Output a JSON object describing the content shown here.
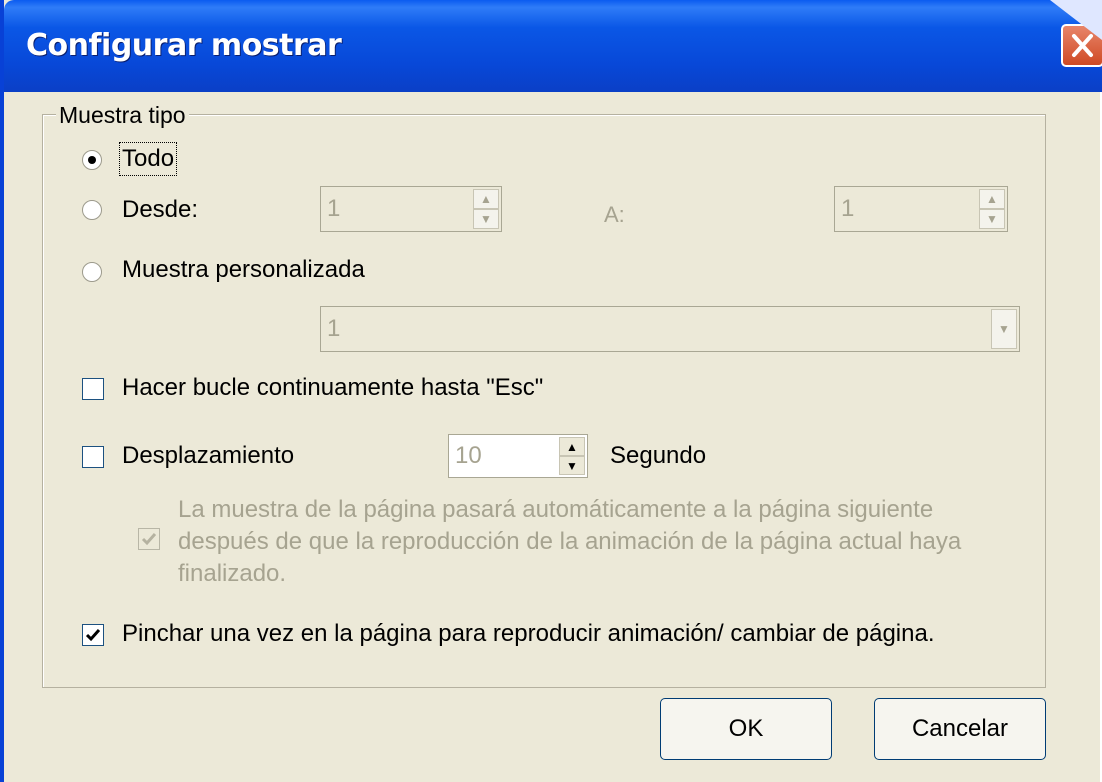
{
  "window": {
    "title": "Configurar mostrar"
  },
  "group": {
    "legend": "Muestra tipo"
  },
  "options": {
    "all": "Todo",
    "from": "Desde:",
    "to": "A:",
    "custom": "Muestra personalizada"
  },
  "fields": {
    "from_value": "1",
    "to_value": "1",
    "custom_value": "1",
    "interval_value": "10"
  },
  "loop": {
    "label": "Hacer bucle continuamente hasta \"Esc\"",
    "checked": false
  },
  "scroll": {
    "label": "Desplazamiento",
    "unit": "Segundo",
    "checked": false
  },
  "auto_advance": {
    "line1": "La muestra de la página pasará automáticamente a la página siguiente",
    "line2": "después de que la reproducción de la animación de la página actual haya",
    "line3": "finalizado.",
    "checked": true,
    "enabled": false
  },
  "click_advance": {
    "label": "Pinchar una vez en la página para reproducir animación/ cambiar de página.",
    "checked": true
  },
  "buttons": {
    "ok": "OK",
    "cancel": "Cancelar"
  },
  "colors": {
    "title_bar": "#0a57e6",
    "dialog_bg": "#ece9d8",
    "close_button": "#d75b38"
  }
}
